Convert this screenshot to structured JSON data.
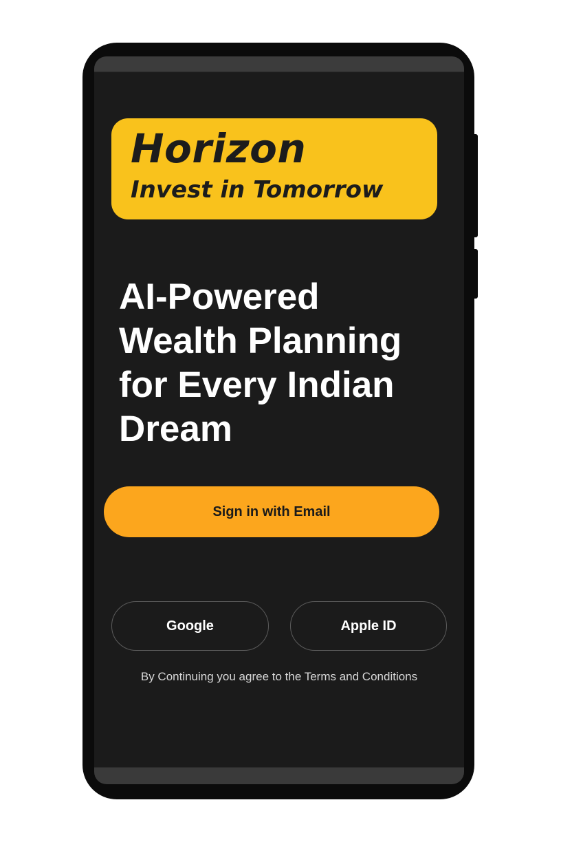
{
  "logo": {
    "title": "Horizon",
    "tagline": "Invest in Tomorrow",
    "background_color": "#f9c21c"
  },
  "headline": "AI-Powered Wealth Planning for Every Indian Dream",
  "actions": {
    "email_label": "Sign in with Email",
    "google_label": "Google",
    "apple_label": "Apple ID"
  },
  "legal_text": "By Continuing you agree to the Terms and Conditions",
  "colors": {
    "accent": "#fca61d",
    "screen_background": "#1b1b1b",
    "text": "#ffffff"
  }
}
